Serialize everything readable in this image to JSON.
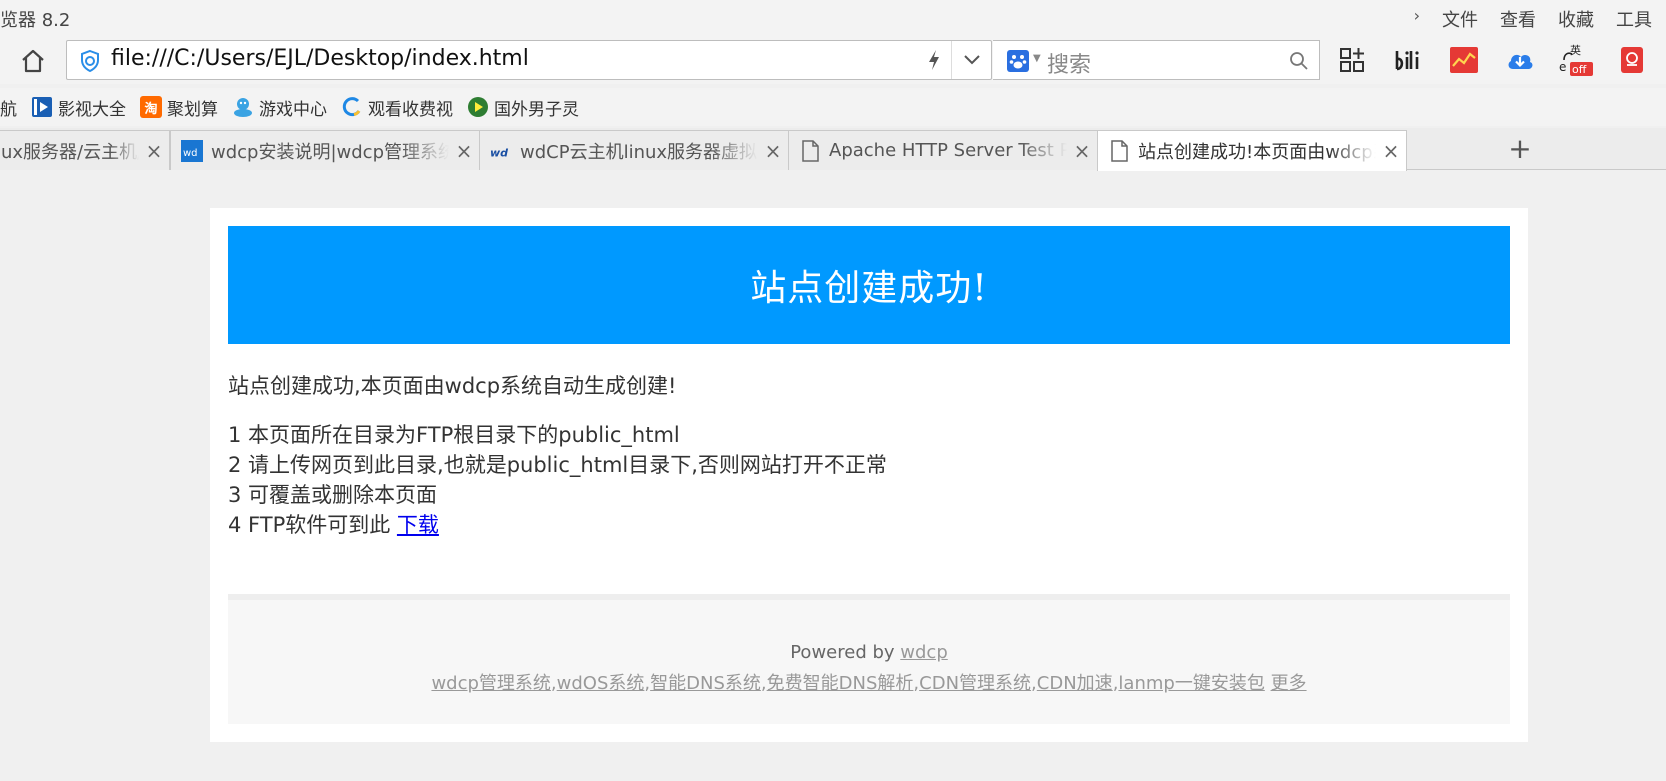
{
  "window": {
    "app_title": "览器 8.2",
    "menus": [
      "文件",
      "查看",
      "收藏",
      "工具"
    ]
  },
  "navbar": {
    "url": "file:///C:/Users/EJL/Desktop/index.html",
    "search_placeholder": "搜索",
    "tools": [
      "apps-grid-icon",
      "bilibili-icon",
      "stock-chart-icon",
      "cloud-download-icon",
      "translate-off-icon",
      "red-envelope-icon"
    ],
    "translate_badge": "off",
    "translate_char": "英"
  },
  "bookmarks": [
    {
      "label": "航",
      "icon": "nav-icon"
    },
    {
      "label": "影视大全",
      "icon": "video-icon",
      "color": "#1a5fb4"
    },
    {
      "label": "聚划算",
      "icon": "taobao-icon",
      "color": "#ff6a00",
      "glyph": "淘"
    },
    {
      "label": "游戏中心",
      "icon": "game-icon",
      "color": "#3aa3e3"
    },
    {
      "label": "观看收费视",
      "icon": "ring-icon",
      "color": "#1e88e5"
    },
    {
      "label": "国外男子灵",
      "icon": "play-icon",
      "color": "#2e7d32"
    }
  ],
  "tabs": [
    {
      "label": "ux服务器/云主机/",
      "icon": "none"
    },
    {
      "label": "wdcp安装说明|wdcp管理系统",
      "icon": "wdcp-blue-icon"
    },
    {
      "label": "wdCP云主机linux服务器虚拟主",
      "icon": "wdcp-logo-icon"
    },
    {
      "label": "Apache HTTP Server Test Pa",
      "icon": "page-icon"
    },
    {
      "label": "站点创建成功!本页面由wdcp系",
      "icon": "page-icon",
      "active": true
    }
  ],
  "page": {
    "banner_title": "站点创建成功!",
    "intro": "站点创建成功,本页面由wdcp系统自动生成创建!",
    "steps": [
      "1 本页面所在目录为FTP根目录下的public_html",
      "2 请上传网页到此目录,也就是public_html目录下,否则网站打开不正常",
      "3 可覆盖或删除本页面",
      "4 FTP软件可到此 "
    ],
    "download_link": "下载",
    "powered_prefix": "Powered by ",
    "powered_link": "wdcp",
    "footer_links": [
      "wdcp管理系统",
      "wdOS系统",
      "智能DNS系统",
      "免费智能DNS解析",
      "CDN管理系统",
      "CDN加速",
      "lanmp一键安装包"
    ],
    "more_link": "更多",
    "colors": {
      "banner": "#0099ff",
      "link": "#0000ee"
    }
  }
}
